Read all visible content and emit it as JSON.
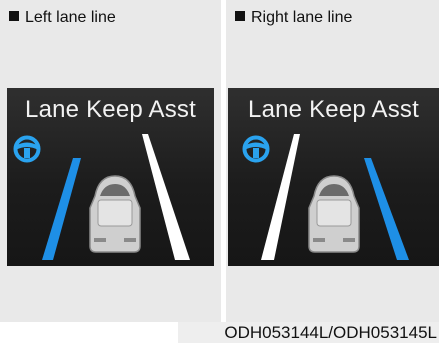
{
  "panels": [
    {
      "caption": "Left lane line",
      "screen_title": "Lane Keep Asst",
      "highlighted_lane": "left"
    },
    {
      "caption": "Right lane line",
      "screen_title": "Lane Keep Asst",
      "highlighted_lane": "right"
    }
  ],
  "icons": [
    "steering-wheel-icon",
    "vehicle-icon"
  ],
  "colors": {
    "highlight_lane": "#1e8fe6",
    "normal_lane": "#ffffff",
    "steering_icon": "#2aa3ef"
  },
  "footer": {
    "code": "ODH053144L/ODH053145L"
  }
}
